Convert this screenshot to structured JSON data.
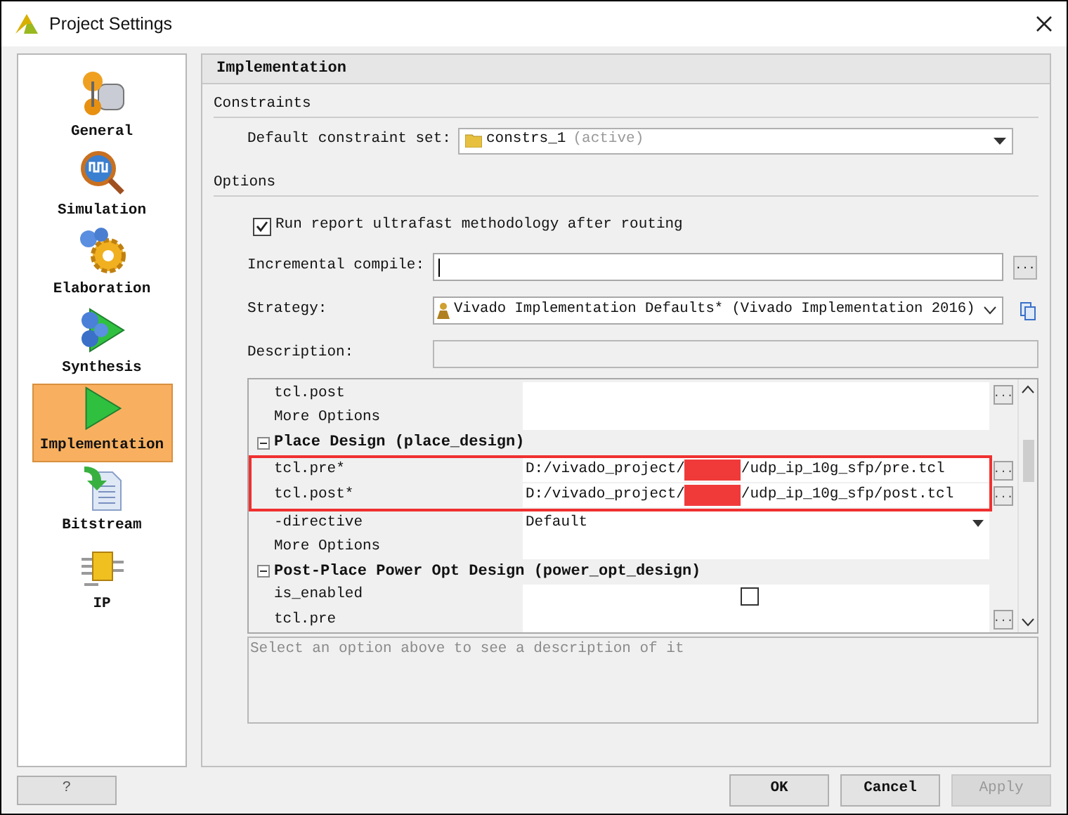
{
  "window": {
    "title": "Project Settings"
  },
  "sidebar": {
    "items": [
      {
        "label": "General",
        "selected": false
      },
      {
        "label": "Simulation",
        "selected": false
      },
      {
        "label": "Elaboration",
        "selected": false
      },
      {
        "label": "Synthesis",
        "selected": false
      },
      {
        "label": "Implementation",
        "selected": true
      },
      {
        "label": "Bitstream",
        "selected": false
      },
      {
        "label": "IP",
        "selected": false
      }
    ]
  },
  "panel": {
    "title": "Implementation",
    "constraints": {
      "heading": "Constraints",
      "label": "Default constraint set:",
      "value": "constrs_1",
      "note": "(active)"
    },
    "options": {
      "heading": "Options",
      "ultrafast": {
        "label": "Run report ultrafast methodology after routing",
        "checked": true
      },
      "incremental": {
        "label": "Incremental compile:",
        "browse": "..."
      },
      "strategy": {
        "label": "Strategy:",
        "value": "Vivado Implementation Defaults* (Vivado Implementation 2016)"
      },
      "description": {
        "label": "Description:"
      }
    },
    "grid": {
      "rows": [
        {
          "kind": "property",
          "name": "tcl.post",
          "button": "...",
          "highlighted": false
        },
        {
          "kind": "property",
          "name": "More Options",
          "highlighted": false
        },
        {
          "kind": "section",
          "name": "Place Design (place_design)",
          "expanded": true
        },
        {
          "kind": "property",
          "name": "tcl.pre*",
          "value_prefix": "D:/vivado_project/",
          "redacted": true,
          "value_suffix": "/udp_ip_10g_sfp/pre.tcl",
          "button": "...",
          "highlighted": true
        },
        {
          "kind": "property",
          "name": "tcl.post*",
          "value_prefix": "D:/vivado_project/",
          "redacted": true,
          "value_suffix": "/udp_ip_10g_sfp/post.tcl",
          "button": "...",
          "highlighted": true
        },
        {
          "kind": "dropdown",
          "name": "-directive",
          "value": "Default",
          "highlighted": false
        },
        {
          "kind": "property",
          "name": "More Options",
          "highlighted": false
        },
        {
          "kind": "section",
          "name": "Post-Place Power Opt Design (power_opt_design)",
          "expanded": true
        },
        {
          "kind": "checkbox",
          "name": "is_enabled",
          "checked": false,
          "highlighted": false
        },
        {
          "kind": "property",
          "name": "tcl.pre",
          "button": "...",
          "highlighted": false
        }
      ]
    },
    "hint": "Select an option above to see a description of it"
  },
  "buttons": {
    "help": "?",
    "ok": "OK",
    "cancel": "Cancel",
    "apply": {
      "label": "Apply",
      "disabled": true
    }
  }
}
